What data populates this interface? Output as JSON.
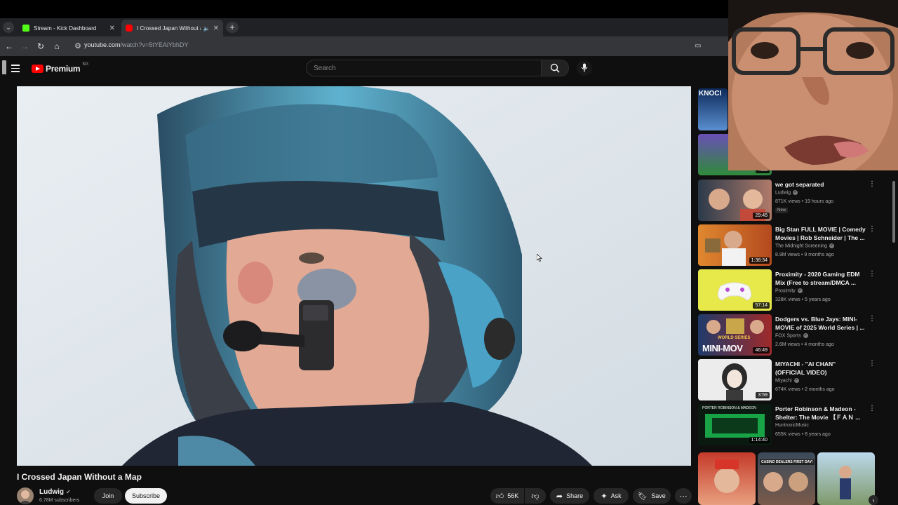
{
  "browser": {
    "tabs": [
      {
        "title": "Stream - Kick Dashboard",
        "favicon_color": "#53fc18"
      },
      {
        "title": "I Crossed Japan Without a Map",
        "favicon_color": "#ff0000"
      }
    ],
    "url": "youtube.com/watch?v=5tYEAiYbhDY",
    "url_host": "youtube.com",
    "url_path": "/watch?v=5tYEAiYbhDY"
  },
  "youtube": {
    "logo_text": "Premium",
    "country": "SG",
    "search_placeholder": "Search"
  },
  "video": {
    "title": "I Crossed Japan Without a Map",
    "channel": "Ludwig",
    "subscribers": "6.78M subscribers",
    "join_label": "Join",
    "subscribe_label": "Subscribe",
    "likes": "56K",
    "share_label": "Share",
    "ask_label": "Ask",
    "save_label": "Save"
  },
  "recommendations": [
    {
      "title": "we got separated",
      "channel": "Ludwig",
      "meta": "871K views • 19 hours ago",
      "duration": "29:45",
      "badge": "New",
      "verified": true
    },
    {
      "title": "Big Stan FULL MOVIE | Comedy Movies | Rob Schneider | The ...",
      "channel": "The Midnight Screening",
      "meta": "8.9M views • 9 months ago",
      "duration": "1:38:34",
      "verified": true
    },
    {
      "title": "Proximity - 2020 Gaming EDM Mix (Free to stream/DMCA ...",
      "channel": "Proximity",
      "meta": "328K views • 5 years ago",
      "duration": "57:14",
      "verified": true
    },
    {
      "title": "Dodgers vs. Blue Jays: MINI-MOVIE of 2025 World Series | ...",
      "channel": "FOX Sports",
      "meta": "2.6M views • 4 months ago",
      "duration": "46:49",
      "verified": true
    },
    {
      "title": "MIYACHI - \"AI CHAN\" (OFFICIAL VIDEO)",
      "channel": "Miyachi",
      "meta": "674K views • 2 months ago",
      "duration": "3:59",
      "verified": true
    },
    {
      "title": "Porter Robinson & Madeon - Shelter: The Movie 【ＦＡＮ ...",
      "channel": "HuntroxicMusic",
      "meta": "655K views • 8 years ago",
      "duration": "1:14:40",
      "verified": false
    }
  ],
  "partial_thumbs": {
    "top_text": "KNOCI",
    "top2_duration": "4:28",
    "thumb_text_1": "MINI-MOV",
    "thumb_text_2": "WORLD SERIES",
    "thumb_text_3": "CASINO DEALERS FIRST DAY!",
    "thumb_text_4": "PORTER ROBINSON & MADEON"
  }
}
